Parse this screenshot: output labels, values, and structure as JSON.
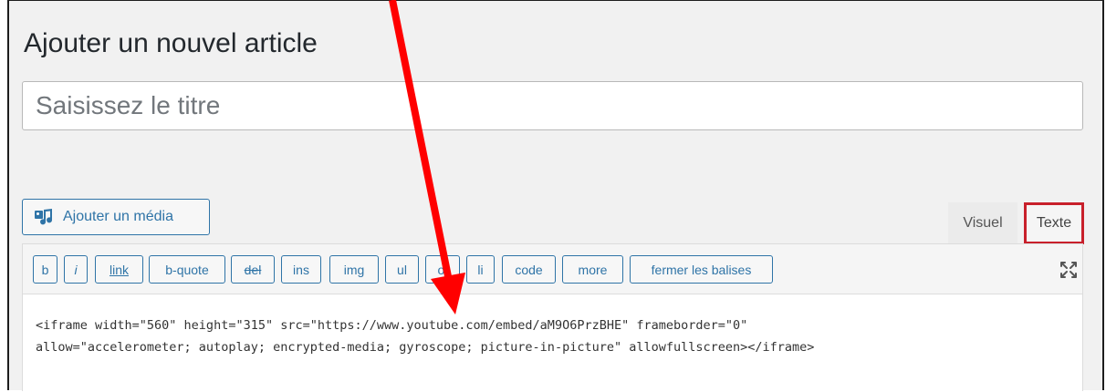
{
  "header": {
    "title": "Ajouter un nouvel article"
  },
  "title_field": {
    "placeholder": "Saisissez le titre",
    "value": ""
  },
  "media": {
    "button_label": "Ajouter un média",
    "icon": "media-icon"
  },
  "tabs": {
    "visual": "Visuel",
    "text": "Texte",
    "active": "Texte"
  },
  "quicktags": [
    "b",
    "i",
    "link",
    "b-quote",
    "del",
    "ins",
    "img",
    "ul",
    "ol",
    "li",
    "code",
    "more",
    "fermer les balises"
  ],
  "fullscreen": {
    "icon": "fullscreen-icon"
  },
  "content": {
    "lines": [
      "<iframe width=\"560\" height=\"315\" src=\"https://www.youtube.com/embed/aM9O6PrzBHE\" frameborder=\"0\"",
      "allow=\"accelerometer; autoplay; encrypted-media; gyroscope; picture-in-picture\" allowfullscreen></iframe>"
    ]
  },
  "colors": {
    "accent": "#2f74a7",
    "highlight_box": "#c8202b",
    "annotation_arrow": "#ff0000",
    "background": "#f1f1f1"
  }
}
